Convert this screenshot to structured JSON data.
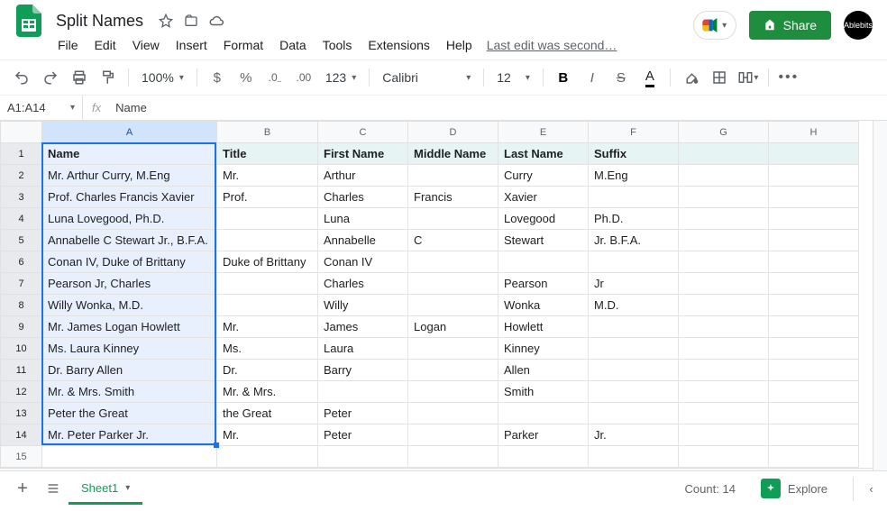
{
  "doc": {
    "title": "Split Names",
    "last_edit": "Last edit was second…"
  },
  "menus": {
    "file": "File",
    "edit": "Edit",
    "view": "View",
    "insert": "Insert",
    "format": "Format",
    "data": "Data",
    "tools": "Tools",
    "extensions": "Extensions",
    "help": "Help"
  },
  "share": {
    "label": "Share"
  },
  "avatar": {
    "label": "Ablebits"
  },
  "toolbar": {
    "zoom": "100%",
    "num_format": "123",
    "font": "Calibri",
    "font_size": "12"
  },
  "namebox": {
    "ref": "A1:A14",
    "formula_preview": "Name"
  },
  "columns": {
    "labels": [
      "A",
      "B",
      "C",
      "D",
      "E",
      "F",
      "G",
      "H"
    ],
    "widths": [
      194,
      112,
      100,
      100,
      100,
      100,
      100,
      100
    ]
  },
  "header_row": [
    "Name",
    "Title",
    "First Name",
    "Middle Name",
    "Last Name",
    "Suffix",
    "",
    ""
  ],
  "rows": [
    [
      "Mr. Arthur Curry, M.Eng",
      "Mr.",
      "Arthur",
      "",
      "Curry",
      "M.Eng",
      "",
      ""
    ],
    [
      "Prof. Charles Francis Xavier",
      "Prof.",
      "Charles",
      "Francis",
      "Xavier",
      "",
      "",
      ""
    ],
    [
      "Luna Lovegood, Ph.D.",
      "",
      "Luna",
      "",
      "Lovegood",
      "Ph.D.",
      "",
      ""
    ],
    [
      "Annabelle C Stewart Jr., B.F.A.",
      "",
      "Annabelle",
      "C",
      "Stewart",
      "Jr. B.F.A.",
      "",
      ""
    ],
    [
      "Conan IV, Duke of Brittany",
      "Duke of Brittany",
      "Conan IV",
      "",
      "",
      "",
      "",
      ""
    ],
    [
      "Pearson Jr, Charles",
      "",
      "Charles",
      "",
      "Pearson",
      "Jr",
      "",
      ""
    ],
    [
      "Willy Wonka, M.D.",
      "",
      "Willy",
      "",
      "Wonka",
      "M.D.",
      "",
      ""
    ],
    [
      "Mr. James Logan Howlett",
      "Mr.",
      "James",
      "Logan",
      "Howlett",
      "",
      "",
      ""
    ],
    [
      "Ms. Laura Kinney",
      "Ms.",
      "Laura",
      "",
      "Kinney",
      "",
      "",
      ""
    ],
    [
      "Dr. Barry Allen",
      "Dr.",
      "Barry",
      "",
      "Allen",
      "",
      "",
      ""
    ],
    [
      "Mr. & Mrs. Smith",
      "Mr. & Mrs.",
      "",
      "",
      "Smith",
      "",
      "",
      ""
    ],
    [
      "Peter the Great",
      "the Great",
      "Peter",
      "",
      "",
      "",
      "",
      ""
    ],
    [
      "Mr. Peter Parker Jr.",
      "Mr.",
      "Peter",
      "",
      "Parker",
      "Jr.",
      "",
      ""
    ]
  ],
  "blank_rows": 1,
  "selection": {
    "col": 0,
    "row_start": 0,
    "row_end": 13
  },
  "bottombar": {
    "sheet_name": "Sheet1",
    "count": "Count: 14",
    "explore": "Explore"
  }
}
